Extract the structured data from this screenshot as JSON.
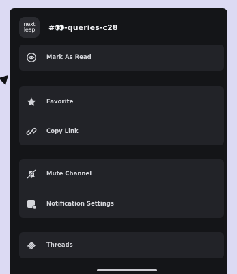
{
  "app": {
    "logo_line1": "next",
    "logo_line2": "leap",
    "channel_title": "#👀-queries-c28"
  },
  "menu": {
    "groups": [
      {
        "items": [
          {
            "label": "Mark As Read",
            "icon": "eye-icon"
          }
        ]
      },
      {
        "items": [
          {
            "label": "Favorite",
            "icon": "star-icon"
          },
          {
            "label": "Copy Link",
            "icon": "link-icon"
          }
        ]
      },
      {
        "items": [
          {
            "label": "Mute Channel",
            "icon": "bell-off-icon"
          },
          {
            "label": "Notification Settings",
            "icon": "notification-settings-icon"
          }
        ]
      },
      {
        "items": [
          {
            "label": "Threads",
            "icon": "threads-icon"
          }
        ]
      }
    ]
  },
  "colors": {
    "background": "#dcdaf3",
    "sheet": "#141518",
    "group": "#222328",
    "text": "#d4d5da"
  }
}
